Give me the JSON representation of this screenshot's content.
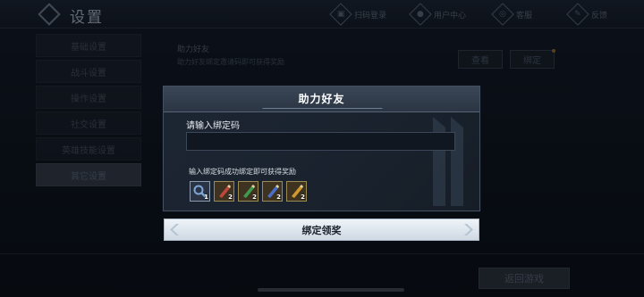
{
  "topbar": {
    "title": "设置",
    "items": [
      {
        "label": "扫码登录",
        "icon": "scan-icon"
      },
      {
        "label": "用户中心",
        "icon": "user-icon"
      },
      {
        "label": "客服",
        "icon": "support-icon"
      },
      {
        "label": "反馈",
        "icon": "feedback-icon"
      }
    ]
  },
  "menu": {
    "items": [
      {
        "label": "基础设置"
      },
      {
        "label": "战斗设置"
      },
      {
        "label": "操作设置"
      },
      {
        "label": "社交设置"
      },
      {
        "label": "英雄技能设置"
      },
      {
        "label": "其它设置"
      }
    ],
    "active_index": 5
  },
  "background_row": {
    "title": "助力好友",
    "description": "助力好友绑定邀请码即可获得奖励",
    "view_label": "查看",
    "bind_label": "绑定"
  },
  "return_label": "返回游戏",
  "dialog": {
    "title": "助力好友",
    "input_label": "请输入绑定码",
    "input_value": "",
    "reward_desc": "输入绑定码成功绑定即可获得奖励",
    "rewards": [
      {
        "icon": "magnifier-item-icon",
        "count": "1",
        "color": "#7ea6d8"
      },
      {
        "icon": "red-scroll-item-icon",
        "count": "2",
        "color": "#c0453a"
      },
      {
        "icon": "green-scroll-item-icon",
        "count": "2",
        "color": "#3f9a4e"
      },
      {
        "icon": "blue-scroll-item-icon",
        "count": "2",
        "color": "#4a6ec8"
      },
      {
        "icon": "gold-scroll-item-icon",
        "count": "2",
        "color": "#d29a2e"
      }
    ]
  },
  "bind_button_label": "绑定领奖"
}
